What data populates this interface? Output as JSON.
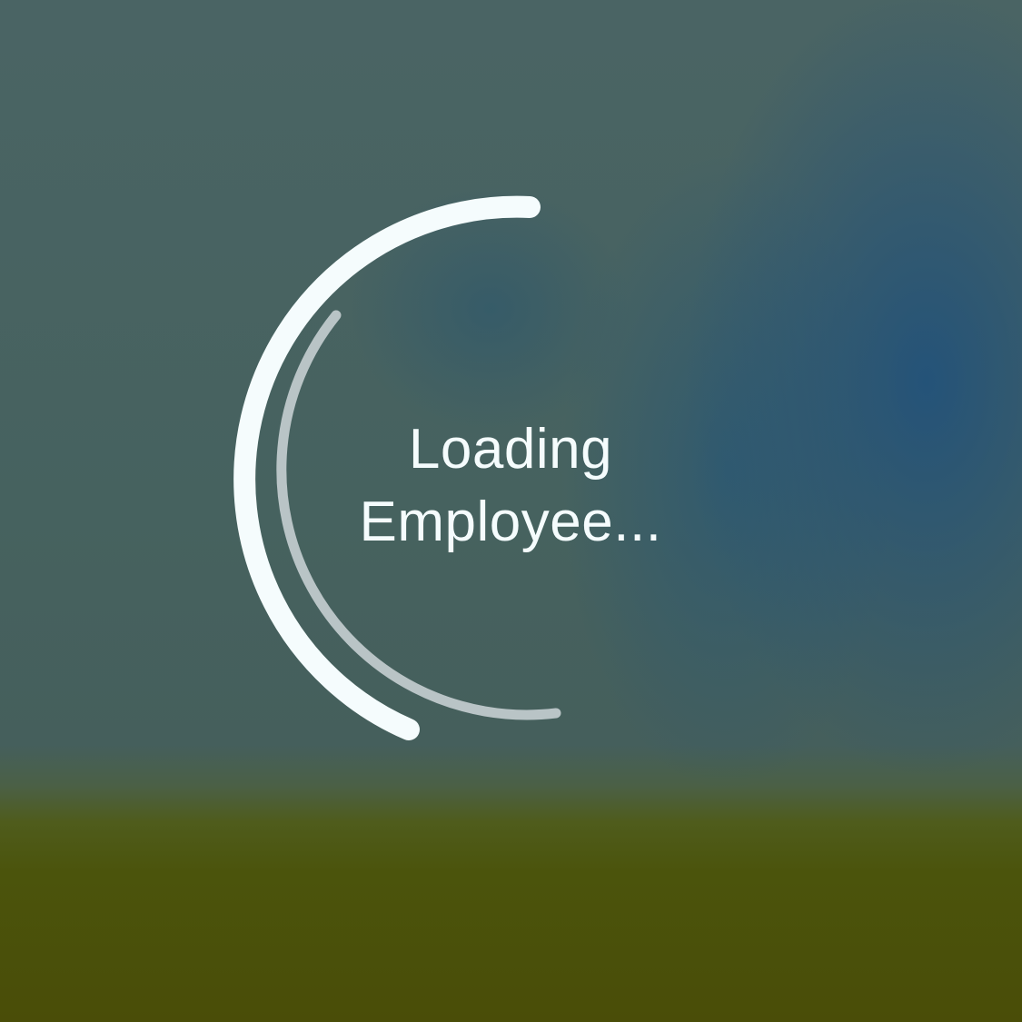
{
  "loading_screen": {
    "message": "Loading\nEmployee...",
    "spinner_icon": "loading-spinner-icon",
    "colors": {
      "primary_arc": "#f5fcfd",
      "secondary_arc": "#b9c4c6",
      "text": "#f5fcfd"
    }
  }
}
